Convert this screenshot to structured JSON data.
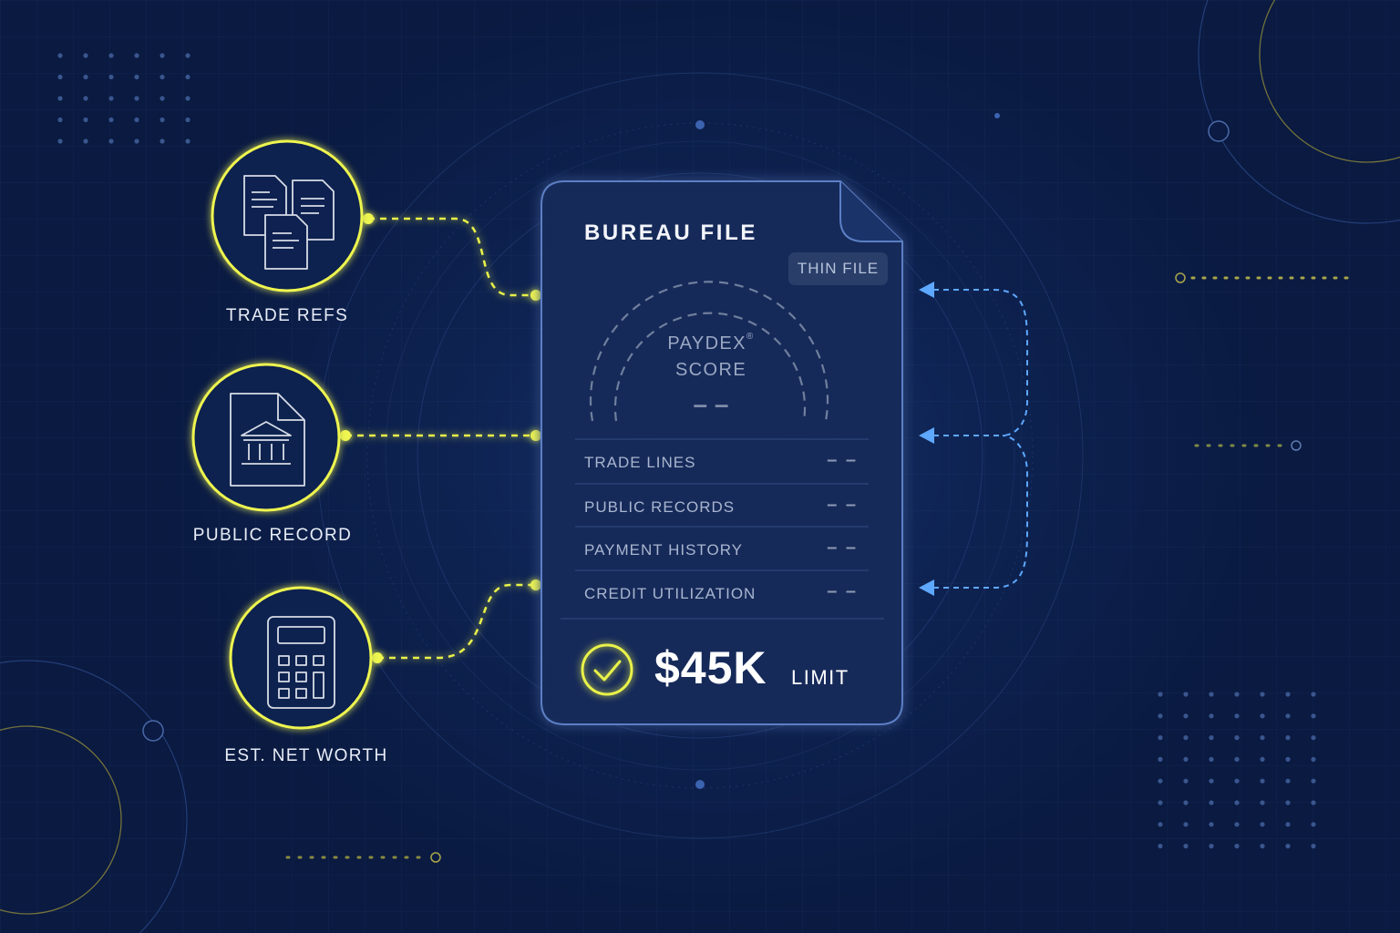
{
  "nodes": [
    {
      "id": "trade-refs",
      "label": "TRADE REFS",
      "icon": "documents-icon"
    },
    {
      "id": "public-record",
      "label": "PUBLIC RECORD",
      "icon": "bank-document-icon"
    },
    {
      "id": "net-worth",
      "label": "EST. NET WORTH",
      "icon": "calculator-icon"
    }
  ],
  "card": {
    "title": "BUREAU FILE",
    "badge": "THIN FILE",
    "gauge_label_1": "PAYDEX",
    "gauge_label_mark": "®",
    "gauge_label_2": "SCORE",
    "gauge_value": "– –",
    "rows": [
      {
        "label": "TRADE LINES",
        "value": "– –"
      },
      {
        "label": "PUBLIC RECORDS",
        "value": "– –"
      },
      {
        "label": "PAYMENT HISTORY",
        "value": "– –"
      },
      {
        "label": "CREDIT UTILIZATION",
        "value": "– –"
      }
    ],
    "limit_amount": "$45K",
    "limit_label": "LIMIT",
    "status_icon": "check-circle-icon"
  },
  "colors": {
    "background": "#0b1b44",
    "accent_yellow": "#e9f24a",
    "accent_blue": "#5ea8ff",
    "card_border": "#5b7fc4"
  }
}
